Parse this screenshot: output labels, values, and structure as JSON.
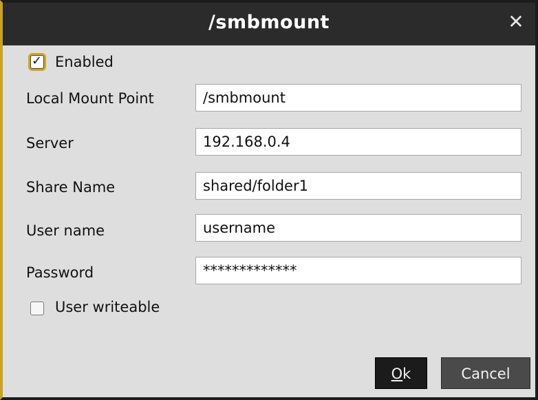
{
  "window": {
    "title": "/smbmount",
    "close_glyph": "✕",
    "icons": {
      "close": "close-icon",
      "check": "checkmark-icon"
    }
  },
  "form": {
    "enabled": {
      "label": "Enabled",
      "checked": true
    },
    "local_mount_point": {
      "label": "Local Mount Point",
      "value": "/smbmount"
    },
    "server": {
      "label": "Server",
      "value": "192.168.0.4"
    },
    "share_name": {
      "label": "Share Name",
      "value": "shared/folder1"
    },
    "user_name": {
      "label": "User name",
      "value": "username"
    },
    "password": {
      "label": "Password",
      "value": "*************"
    },
    "user_writeable": {
      "label": "User writeable",
      "checked": false
    }
  },
  "buttons": {
    "ok": {
      "mnemonic": "O",
      "rest": "k"
    },
    "cancel": "Cancel"
  },
  "colors": {
    "accent": "#d4a520",
    "titlebar": "#2b2b2b",
    "background": "#dedede"
  }
}
